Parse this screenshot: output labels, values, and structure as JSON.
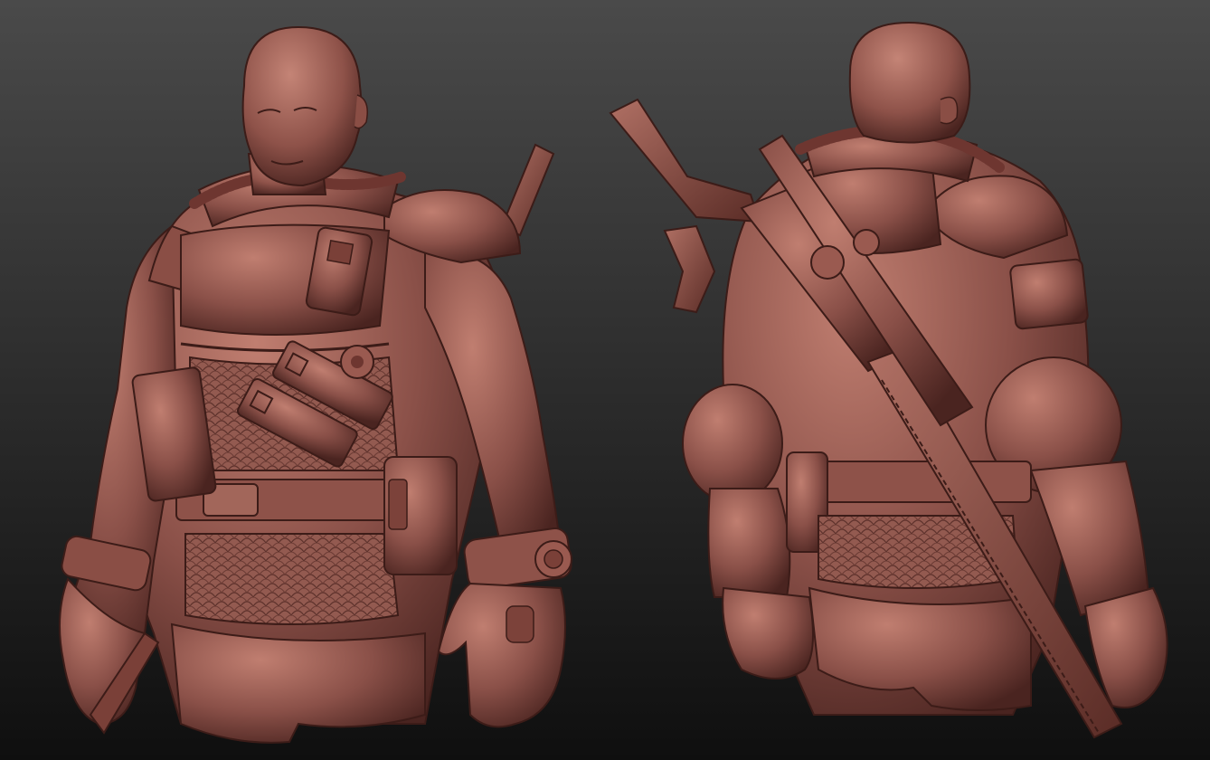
{
  "scene": {
    "background_top": "#4a4a4a",
    "background_bottom": "#0f0f0f",
    "clay_base": "#8a5048",
    "clay_light": "#b8786c",
    "clay_dark": "#3c1c18"
  },
  "views": [
    {
      "name": "front-three-quarter-view"
    },
    {
      "name": "back-view"
    }
  ]
}
